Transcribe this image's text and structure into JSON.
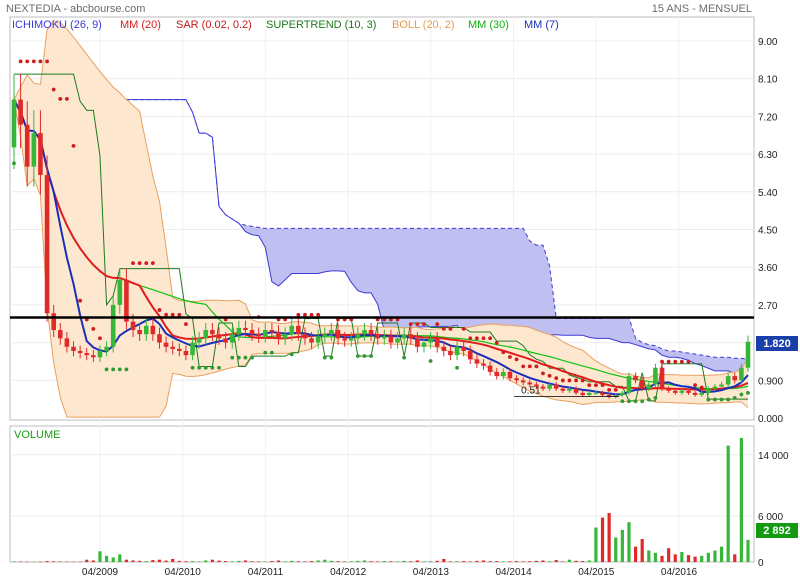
{
  "header": {
    "title": "NEXTEDIA - abcbourse.com",
    "period": "15 ANS - MENSUEL"
  },
  "legend": [
    {
      "label": "ICHIMOKU (26, 9)",
      "color": "#3b3bd6"
    },
    {
      "label": "MM (20)",
      "color": "#d62020"
    },
    {
      "label": "SAR (0.02, 0.2)",
      "color": "#c81818"
    },
    {
      "label": "SUPERTREND (10, 3)",
      "color": "#1e7a1e"
    },
    {
      "label": "BOLL (20, 2)",
      "color": "#e89a50"
    },
    {
      "label": "MM (30)",
      "color": "#10c010"
    },
    {
      "label": "MM (7)",
      "color": "#1a2fb8"
    }
  ],
  "volume_label": "VOLUME",
  "last_price": "1.820",
  "last_volume": "2 892",
  "annotation_low": "0.51",
  "colors": {
    "up": "#37b737",
    "down": "#e02a2a",
    "cloud": "#b4b4ee",
    "boll_fill": "#fde7cf",
    "boll_line": "#e8a060",
    "mm20": "#e01c1c",
    "mm30": "#10c010",
    "mm7": "#1a2fb8",
    "supertrend": "#1e7a1e",
    "sar_up": "#2f9a2f",
    "sar_down": "#d01c1c",
    "resistance": "#000000",
    "badge_price": "#1a3fa8",
    "badge_volume": "#129b12"
  },
  "chart_data": {
    "type": "candlestick",
    "x_ticks": [
      "04/2009",
      "04/2010",
      "04/2011",
      "04/2012",
      "04/2013",
      "04/2014",
      "04/2015",
      "04/2016"
    ],
    "price_axis": {
      "ticks": [
        "9.00",
        "8.10",
        "7.20",
        "6.30",
        "5.40",
        "4.50",
        "3.60",
        "2.70",
        "1.80",
        "0.900",
        "0.000"
      ],
      "ylim": [
        0,
        9.5
      ]
    },
    "volume_axis": {
      "ticks": [
        "14 000",
        "6 000",
        "0"
      ],
      "ylim": [
        0,
        17500
      ]
    },
    "resistance_level": 2.4,
    "closes": [
      7.6,
      7.0,
      6.0,
      6.8,
      5.8,
      2.5,
      2.1,
      1.9,
      1.7,
      1.6,
      1.55,
      1.5,
      1.45,
      1.6,
      1.7,
      2.7,
      3.3,
      2.3,
      2.1,
      2.0,
      2.2,
      2.0,
      1.8,
      1.7,
      1.65,
      1.6,
      1.5,
      1.8,
      1.9,
      2.1,
      2.0,
      1.9,
      1.8,
      2.0,
      2.15,
      2.1,
      2.0,
      1.95,
      2.1,
      2.05,
      1.9,
      2.0,
      2.2,
      2.0,
      1.9,
      1.8,
      1.95,
      2.0,
      2.1,
      1.9,
      1.85,
      1.9,
      2.0,
      2.1,
      2.0,
      1.9,
      1.95,
      1.8,
      1.9,
      2.0,
      1.9,
      1.7,
      1.8,
      1.9,
      1.7,
      1.6,
      1.5,
      1.7,
      1.6,
      1.4,
      1.3,
      1.25,
      1.1,
      1.0,
      1.1,
      0.95,
      0.9,
      0.85,
      0.8,
      0.75,
      0.7,
      0.8,
      0.7,
      0.65,
      0.7,
      0.6,
      0.55,
      0.6,
      0.6,
      0.55,
      0.5,
      0.55,
      0.6,
      1.0,
      0.9,
      0.7,
      0.8,
      1.2,
      0.7,
      0.65,
      0.6,
      0.65,
      0.6,
      0.55,
      0.6,
      0.7,
      0.75,
      0.8,
      1.0,
      0.9,
      1.2,
      1.82
    ],
    "volumes": [
      80,
      60,
      50,
      40,
      45,
      120,
      90,
      70,
      60,
      50,
      40,
      300,
      200,
      1400,
      800,
      600,
      1000,
      300,
      200,
      150,
      120,
      250,
      300,
      180,
      400,
      150,
      100,
      120,
      80,
      200,
      300,
      180,
      120,
      90,
      150,
      200,
      100,
      80,
      60,
      120,
      200,
      90,
      150,
      100,
      80,
      120,
      200,
      300,
      150,
      100,
      80,
      90,
      150,
      200,
      100,
      80,
      120,
      100,
      80,
      150,
      100,
      200,
      80,
      100,
      150,
      400,
      80,
      100,
      120,
      80,
      150,
      200,
      100,
      120,
      80,
      90,
      120,
      80,
      100,
      150,
      200,
      100,
      250,
      80,
      300,
      150,
      120,
      200,
      4500,
      5800,
      6400,
      3200,
      4200,
      5200,
      2000,
      3000,
      1500,
      1200,
      800,
      1800,
      1000,
      1300,
      900,
      700,
      800,
      1200,
      1500,
      2000,
      15200,
      1000,
      16200,
      2892
    ]
  }
}
